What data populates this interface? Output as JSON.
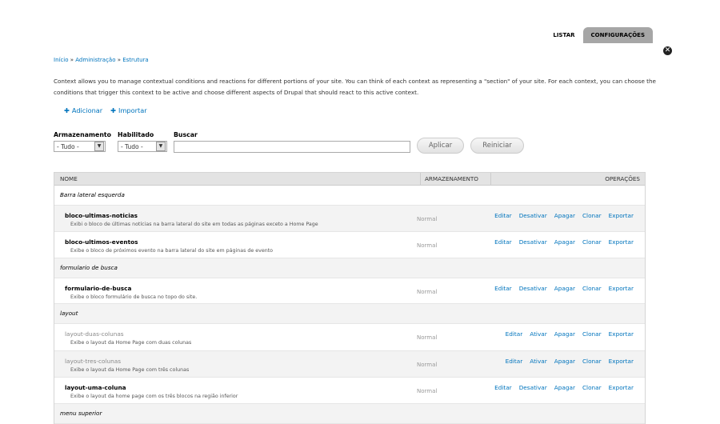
{
  "tabs": {
    "list": "LISTAR",
    "config": "CONFIGURAÇÕES"
  },
  "overlay": {
    "close_icon": "close-icon"
  },
  "breadcrumb": [
    "Início",
    "Administração",
    "Estrutura"
  ],
  "help_text": "Context allows you to manage contextual conditions and reactions for different portions of your site. You can think of each context as representing a \"section\" of your site. For each context, you can choose the conditions that trigger this context to be active and choose different aspects of Drupal that should react to this active context.",
  "actions": {
    "add": "Adicionar",
    "import": "Importar"
  },
  "filters": {
    "storage_label": "Armazenamento",
    "storage_value": "- Tudo -",
    "enabled_label": "Habilitado",
    "enabled_value": "- Tudo -",
    "search_label": "Buscar",
    "search_value": "",
    "apply": "Aplicar",
    "reset": "Reiniciar"
  },
  "table": {
    "headers": {
      "name": "NOME",
      "storage": "ARMAZENAMENTO",
      "ops": "OPERAÇÕES"
    },
    "groups": {
      "barra": "Barra lateral esquerda",
      "formulario": "formulario de busca",
      "layout": "layout",
      "menu": "menu superior"
    },
    "rows": {
      "r1": {
        "name": "bloco-ultimas-noticias",
        "desc": "Exibi o bloco de últimas notícias na barra lateral do site em todas as páginas exceto a Home Page",
        "storage": "Normal",
        "ops": [
          "Editar",
          "Desativar",
          "Apagar",
          "Clonar",
          "Exportar"
        ]
      },
      "r2": {
        "name": "bloco-ultimos-eventos",
        "desc": "Exibe o bloco de próximos evento na barra lateral do site em páginas de evento",
        "storage": "Normal",
        "ops": [
          "Editar",
          "Desativar",
          "Apagar",
          "Clonar",
          "Exportar"
        ]
      },
      "r3": {
        "name": "formulario-de-busca",
        "desc": "Exibe o bloco formulário de busca no topo do site.",
        "storage": "Normal",
        "ops": [
          "Editar",
          "Desativar",
          "Apagar",
          "Clonar",
          "Exportar"
        ]
      },
      "r4": {
        "name": "layout-duas-colunas",
        "desc": "Exibe o layout da Home Page com duas colunas",
        "storage": "Normal",
        "ops": [
          "Editar",
          "Ativar",
          "Apagar",
          "Clonar",
          "Exportar"
        ]
      },
      "r5": {
        "name": "layout-tres-colunas",
        "desc": "Exibe o layout da Home Page com três colunas",
        "storage": "Normal",
        "ops": [
          "Editar",
          "Ativar",
          "Apagar",
          "Clonar",
          "Exportar"
        ]
      },
      "r6": {
        "name": "layout-uma-coluna",
        "desc": "Exibe o layout da home page com os três blocos na região inferior",
        "storage": "Normal",
        "ops": [
          "Editar",
          "Desativar",
          "Apagar",
          "Clonar",
          "Exportar"
        ]
      }
    }
  }
}
